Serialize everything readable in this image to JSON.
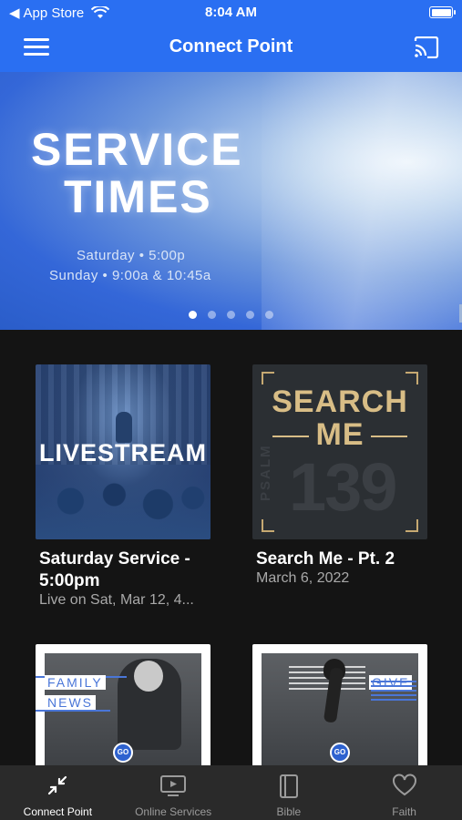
{
  "status_bar": {
    "back_label": "App Store",
    "time": "8:04 AM"
  },
  "header": {
    "title": "Connect Point"
  },
  "hero": {
    "title_line1": "SERVICE",
    "title_line2": "TIMES",
    "line1": "Saturday • 5:00p",
    "line2": "Sunday • 9:00a & 10:45a",
    "page_count": 5,
    "active_page": 1
  },
  "cards": [
    {
      "thumb_text": "LIVESTREAM",
      "title": "Saturday Service - 5:00pm",
      "subtitle": "Live on Sat, Mar 12, 4..."
    },
    {
      "thumb_text_1": "SEARCH",
      "thumb_text_2": "ME",
      "thumb_number": "139",
      "thumb_vertical": "PSALM",
      "title": "Search Me - Pt. 2",
      "subtitle": "March 6, 2022"
    },
    {
      "tag1": "FAMILY",
      "tag2": "NEWS",
      "go": "GO"
    },
    {
      "tag1": "GIVE",
      "go": "GO"
    }
  ],
  "tabs": [
    {
      "label": "Connect Point",
      "icon": "compress-arrows-icon",
      "active": true
    },
    {
      "label": "Online Services",
      "icon": "tv-play-icon",
      "active": false
    },
    {
      "label": "Bible",
      "icon": "book-icon",
      "active": false
    },
    {
      "label": "Faith",
      "icon": "heart-icon",
      "active": false
    }
  ],
  "colors": {
    "brand_blue": "#2a6ff2",
    "background": "#141414",
    "tabbar": "#2a2a2a",
    "gold": "#d8bd86"
  }
}
